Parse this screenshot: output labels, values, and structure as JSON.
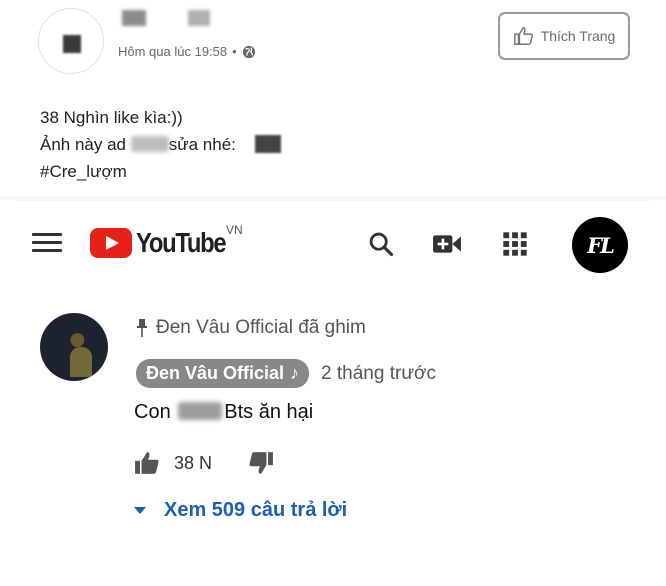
{
  "facebook_post": {
    "timestamp": "Hôm qua lúc 19:58",
    "separator": "•",
    "globe_icon": "globe-icon",
    "like_page_button": "Thích Trang",
    "lines": {
      "line1": "38 Nghìn like kìa:))",
      "line2_a": "Ảnh này ad",
      "line2_b": "sửa nhé:",
      "line3": "#Cre_lượm"
    }
  },
  "youtube": {
    "logo_text": "YouTube",
    "region": "VN",
    "toolbar_icons": [
      "search-icon",
      "video-camera-icon",
      "apps-grid-icon"
    ],
    "account_badge": "FL",
    "comment": {
      "pinned_label": "Đen Vâu Official đã ghim",
      "author": "Đen Vâu Official",
      "author_badge": "♪",
      "time": "2 tháng trước",
      "text_a": "Con",
      "text_b": "Bts ăn hại",
      "like_count": "38 N",
      "replies_label": "Xem 509 câu trả lời"
    },
    "colors": {
      "accent_red": "#e62117",
      "link_blue": "#1a5fb4",
      "chip_gray": "#888888"
    }
  }
}
